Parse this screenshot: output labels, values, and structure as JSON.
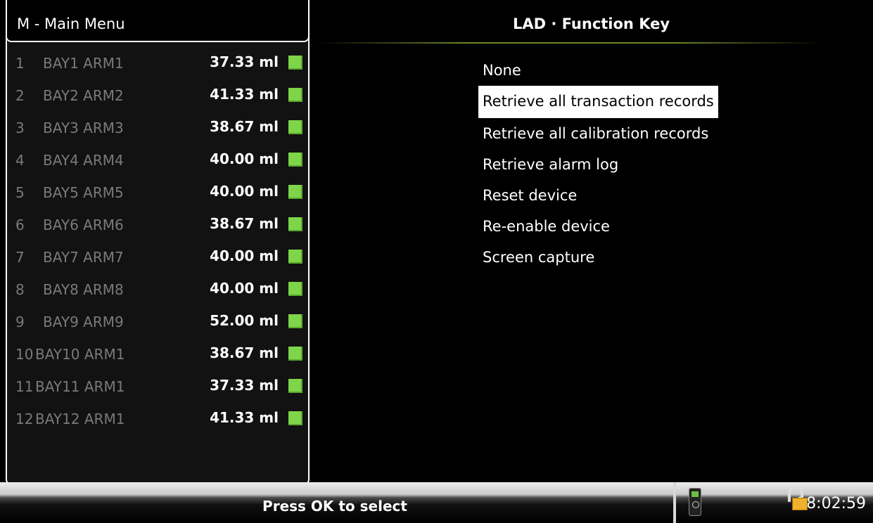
{
  "left_menu": {
    "title": "M - Main Menu",
    "items": [
      {
        "num": "1",
        "name": "BAY1 ARM1",
        "value": "37.33 ml"
      },
      {
        "num": "2",
        "name": "BAY2 ARM2",
        "value": "41.33 ml"
      },
      {
        "num": "3",
        "name": "BAY3 ARM3",
        "value": "38.67 ml"
      },
      {
        "num": "4",
        "name": "BAY4 ARM4",
        "value": "40.00 ml"
      },
      {
        "num": "5",
        "name": "BAY5 ARM5",
        "value": "40.00 ml"
      },
      {
        "num": "6",
        "name": "BAY6 ARM6",
        "value": "38.67 ml"
      },
      {
        "num": "7",
        "name": "BAY7 ARM7",
        "value": "40.00 ml"
      },
      {
        "num": "8",
        "name": "BAY8 ARM8",
        "value": "40.00 ml"
      },
      {
        "num": "9",
        "name": "BAY9 ARM9",
        "value": "52.00 ml"
      },
      {
        "num": "10",
        "name": "BAY10 ARM1",
        "value": "38.67 ml"
      },
      {
        "num": "11",
        "name": "BAY11 ARM1",
        "value": "37.33 ml"
      },
      {
        "num": "12",
        "name": "BAY12 ARM1",
        "value": "41.33 ml"
      }
    ],
    "status_color": "#7fd54a"
  },
  "function_panel": {
    "title": "LAD · Function Key",
    "options": [
      "None",
      "Retrieve all transaction records",
      "Retrieve all calibration records",
      "Retrieve alarm log",
      "Reset device",
      "Re-enable device",
      "Screen capture"
    ],
    "selected_option": "Retrieve all transaction records"
  },
  "status_bar": {
    "prompt": "Press OK to select",
    "time": "18:02:59",
    "icons": [
      "device-icon",
      "unlock-icon"
    ]
  }
}
